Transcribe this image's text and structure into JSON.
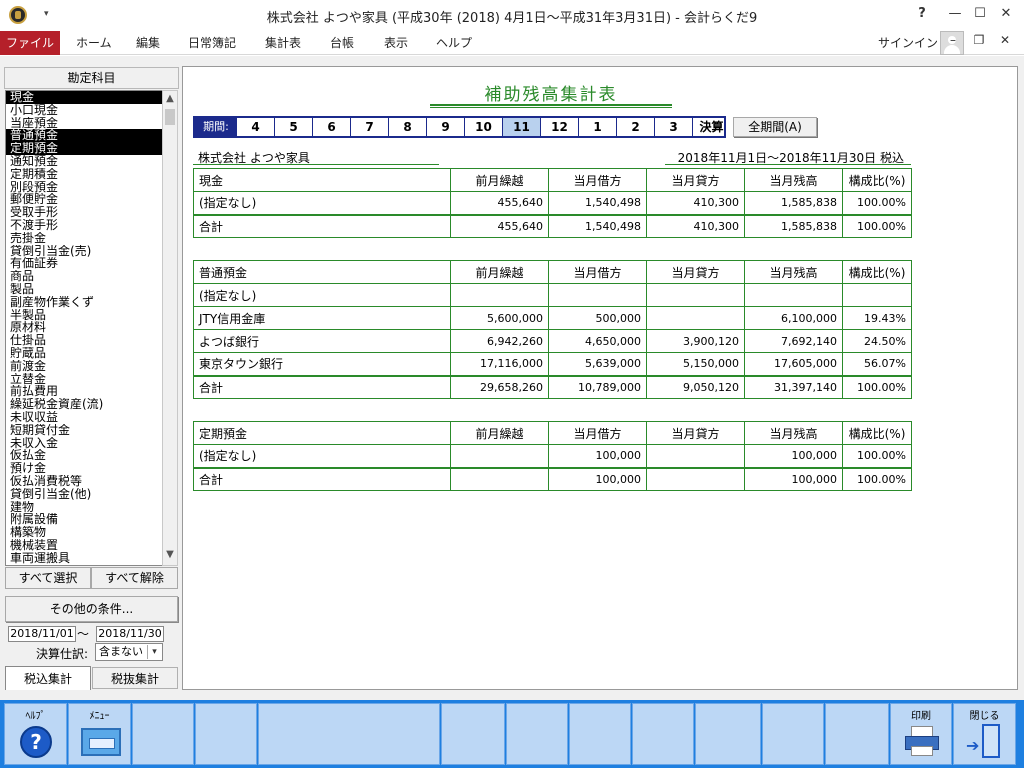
{
  "window": {
    "title": "株式会社 よつや家具 (平成30年 (2018) 4月1日～平成31年3月31日) - 会計らくだ9",
    "help_btn": "?",
    "min_btn": "—",
    "max_btn": "☐",
    "close_btn": "✕"
  },
  "menubar": {
    "items": [
      "ファイル",
      "ホーム",
      "編集",
      "日常簿記",
      "集計表",
      "台帳",
      "表示",
      "ヘルプ"
    ],
    "signin": "サインイン",
    "min": "–",
    "restore": "❐",
    "close": "✕"
  },
  "left_panel": {
    "header": "勘定科目",
    "accounts": [
      {
        "label": "現金",
        "selected": true
      },
      {
        "label": "小口現金",
        "selected": false
      },
      {
        "label": "当座預金",
        "selected": false
      },
      {
        "label": "普通預金",
        "selected": true
      },
      {
        "label": "定期預金",
        "selected": true
      },
      {
        "label": "通知預金",
        "selected": false
      },
      {
        "label": "定期積金",
        "selected": false
      },
      {
        "label": "別段預金",
        "selected": false
      },
      {
        "label": "郵便貯金",
        "selected": false
      },
      {
        "label": "受取手形",
        "selected": false
      },
      {
        "label": "不渡手形",
        "selected": false
      },
      {
        "label": "売掛金",
        "selected": false
      },
      {
        "label": "貸倒引当金(売)",
        "selected": false
      },
      {
        "label": "有価証券",
        "selected": false
      },
      {
        "label": "商品",
        "selected": false
      },
      {
        "label": "製品",
        "selected": false
      },
      {
        "label": "副産物作業くず",
        "selected": false
      },
      {
        "label": "半製品",
        "selected": false
      },
      {
        "label": "原材料",
        "selected": false
      },
      {
        "label": "仕掛品",
        "selected": false
      },
      {
        "label": "貯蔵品",
        "selected": false
      },
      {
        "label": "前渡金",
        "selected": false
      },
      {
        "label": "立替金",
        "selected": false
      },
      {
        "label": "前払費用",
        "selected": false
      },
      {
        "label": "繰延税金資産(流)",
        "selected": false
      },
      {
        "label": "未収収益",
        "selected": false
      },
      {
        "label": "短期貸付金",
        "selected": false
      },
      {
        "label": "未収入金",
        "selected": false
      },
      {
        "label": "仮払金",
        "selected": false
      },
      {
        "label": "預け金",
        "selected": false
      },
      {
        "label": "仮払消費税等",
        "selected": false
      },
      {
        "label": "貸倒引当金(他)",
        "selected": false
      },
      {
        "label": "建物",
        "selected": false
      },
      {
        "label": "附属設備",
        "selected": false
      },
      {
        "label": "構築物",
        "selected": false
      },
      {
        "label": "機械装置",
        "selected": false
      },
      {
        "label": "車両運搬具",
        "selected": false
      }
    ],
    "select_all": "すべて選択",
    "deselect_all": "すべて解除",
    "other_conditions": "その他の条件...",
    "date_from": "2018/11/01",
    "tilde": "～",
    "date_to": "2018/11/30",
    "kessan_label": "決算仕訳:",
    "kessan_value": "含まない",
    "tab_zeikomi": "税込集計",
    "tab_zeinuki": "税抜集計"
  },
  "report": {
    "title": "補助残高集計表",
    "period_label": "期間:",
    "periods": [
      "4",
      "5",
      "6",
      "7",
      "8",
      "9",
      "10",
      "11",
      "12",
      "1",
      "2",
      "3",
      "決算"
    ],
    "current_period": "11",
    "all_period_btn": "全期間(A)",
    "company": "株式会社 よつや家具",
    "date_range": "2018年11月1日～2018年11月30日 税込",
    "columns": [
      "前月繰越",
      "当月借方",
      "当月貸方",
      "当月残高",
      "構成比(%)"
    ],
    "tables": [
      {
        "account": "現金",
        "rows": [
          {
            "name": "(指定なし)",
            "values": [
              "455,640",
              "1,540,498",
              "410,300",
              "1,585,838",
              "100.00%"
            ]
          }
        ],
        "total": {
          "name": "合計",
          "values": [
            "455,640",
            "1,540,498",
            "410,300",
            "1,585,838",
            "100.00%"
          ]
        }
      },
      {
        "account": "普通預金",
        "rows": [
          {
            "name": "(指定なし)",
            "values": [
              "",
              "",
              "",
              "",
              ""
            ]
          },
          {
            "name": "JTY信用金庫",
            "values": [
              "5,600,000",
              "500,000",
              "",
              "6,100,000",
              "19.43%"
            ]
          },
          {
            "name": "よつば銀行",
            "values": [
              "6,942,260",
              "4,650,000",
              "3,900,120",
              "7,692,140",
              "24.50%"
            ]
          },
          {
            "name": "東京タウン銀行",
            "values": [
              "17,116,000",
              "5,639,000",
              "5,150,000",
              "17,605,000",
              "56.07%"
            ]
          }
        ],
        "total": {
          "name": "合計",
          "values": [
            "29,658,260",
            "10,789,000",
            "9,050,120",
            "31,397,140",
            "100.00%"
          ]
        }
      },
      {
        "account": "定期預金",
        "rows": [
          {
            "name": "(指定なし)",
            "values": [
              "",
              "100,000",
              "",
              "100,000",
              "100.00%"
            ]
          }
        ],
        "total": {
          "name": "合計",
          "values": [
            "",
            "100,000",
            "",
            "100,000",
            "100.00%"
          ]
        }
      }
    ]
  },
  "toolbar": {
    "help": "ﾍﾙﾌﾟ",
    "menu": "ﾒﾆｭｰ",
    "print": "印刷",
    "close": "閉じる",
    "help_icon": "help-icon",
    "menu_icon": "menu-icon",
    "print_icon": "printer-icon",
    "close_icon": "exit-door-icon"
  }
}
